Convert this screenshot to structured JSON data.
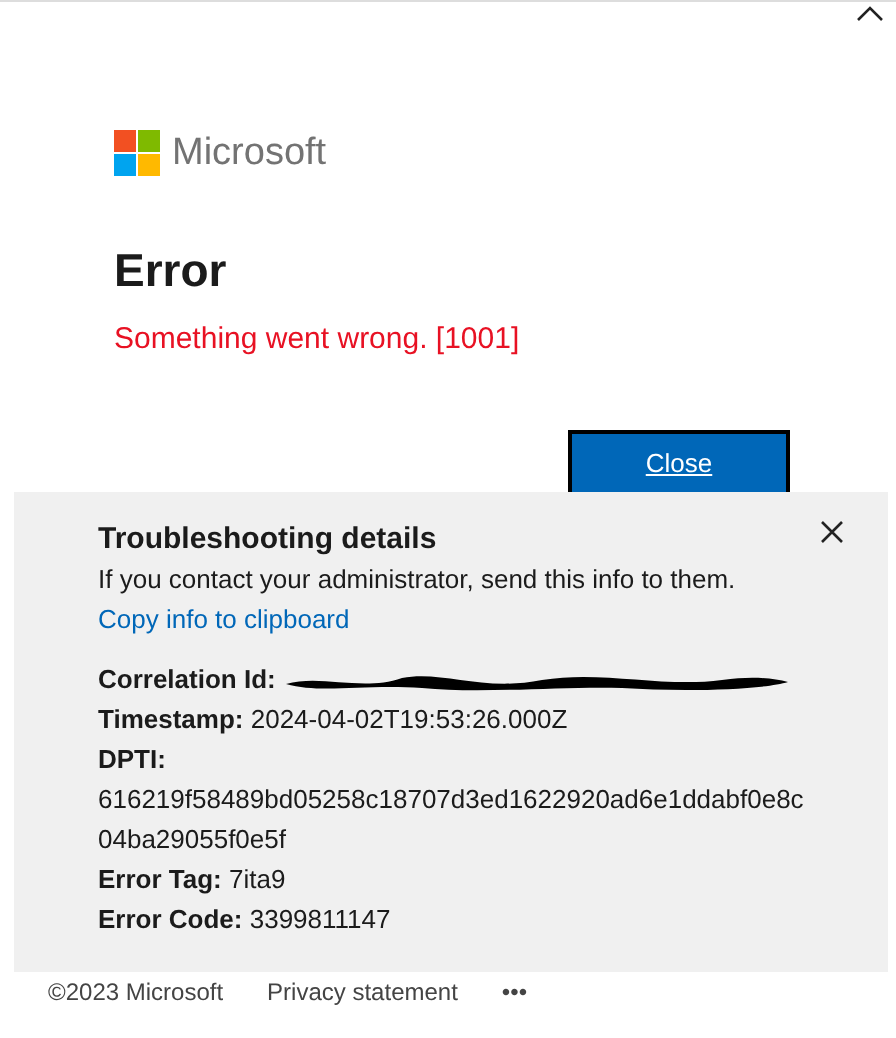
{
  "brand": {
    "name": "Microsoft"
  },
  "title": "Error",
  "message": "Something went wrong. [1001]",
  "close_button": "Close",
  "details": {
    "title": "Troubleshooting details",
    "intro": "If you contact your administrator, send this info to them.",
    "copy_link": "Copy info to clipboard",
    "fields": [
      {
        "kind": "redacted",
        "label": "Correlation Id:"
      },
      {
        "kind": "inline",
        "label": "Timestamp:",
        "value": "2024-04-02T19:53:26.000Z"
      },
      {
        "kind": "block",
        "label": "DPTI:",
        "lines": [
          "616219f58489bd05258c18707d3ed1622920ad6e1ddabf0e8c",
          "04ba29055f0e5f"
        ]
      },
      {
        "kind": "inline",
        "label": "Error Tag:",
        "value": "7ita9"
      },
      {
        "kind": "inline",
        "label": "Error Code:",
        "value": "3399811147"
      }
    ]
  },
  "footer": {
    "copyright": "©2023 Microsoft",
    "privacy": "Privacy statement",
    "more": "•••"
  }
}
